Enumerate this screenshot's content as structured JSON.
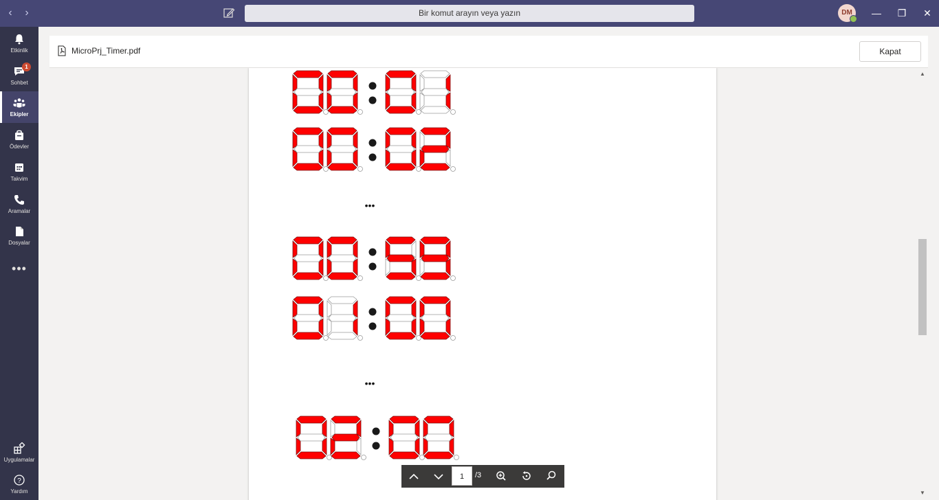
{
  "titlebar": {
    "search_placeholder": "Bir komut arayın veya yazın",
    "avatar_initials": "DM",
    "back": "‹",
    "forward": "›",
    "minimize": "—",
    "restore": "❐",
    "close": "✕"
  },
  "rail": {
    "items": [
      {
        "label": "Etkinlik",
        "icon": "bell-icon"
      },
      {
        "label": "Sohbet",
        "icon": "chat-icon",
        "badge": "1"
      },
      {
        "label": "Ekipler",
        "icon": "teams-icon",
        "active": true
      },
      {
        "label": "Ödevler",
        "icon": "assignments-icon"
      },
      {
        "label": "Takvim",
        "icon": "calendar-icon"
      },
      {
        "label": "Aramalar",
        "icon": "phone-icon"
      },
      {
        "label": "Dosyalar",
        "icon": "files-icon"
      }
    ],
    "more": "•••",
    "apps_label": "Uygulamalar",
    "help_label": "Yardım"
  },
  "file": {
    "name": "MicroPrj_Timer.pdf",
    "close_label": "Kapat"
  },
  "pdf": {
    "ellipsis": "•••",
    "displays": [
      {
        "digits": [
          "0",
          "0",
          "0",
          "1"
        ]
      },
      {
        "digits": [
          "0",
          "0",
          "0",
          "2"
        ]
      },
      {
        "digits": [
          "0",
          "0",
          "5",
          "9"
        ]
      },
      {
        "digits": [
          "0",
          "1",
          "0",
          "0"
        ]
      },
      {
        "digits": [
          "0",
          "2",
          "0",
          "0"
        ]
      }
    ],
    "segment_on_color": "#ff0000"
  },
  "toolbar": {
    "page_current": "1",
    "page_total": "/3",
    "icons": [
      "chevron-up-icon",
      "chevron-down-icon",
      "zoom-in-icon",
      "rotate-icon",
      "search-icon"
    ]
  },
  "colors": {
    "titlebar": "#464775",
    "rail": "#33344a",
    "accent": "#6264a7"
  }
}
